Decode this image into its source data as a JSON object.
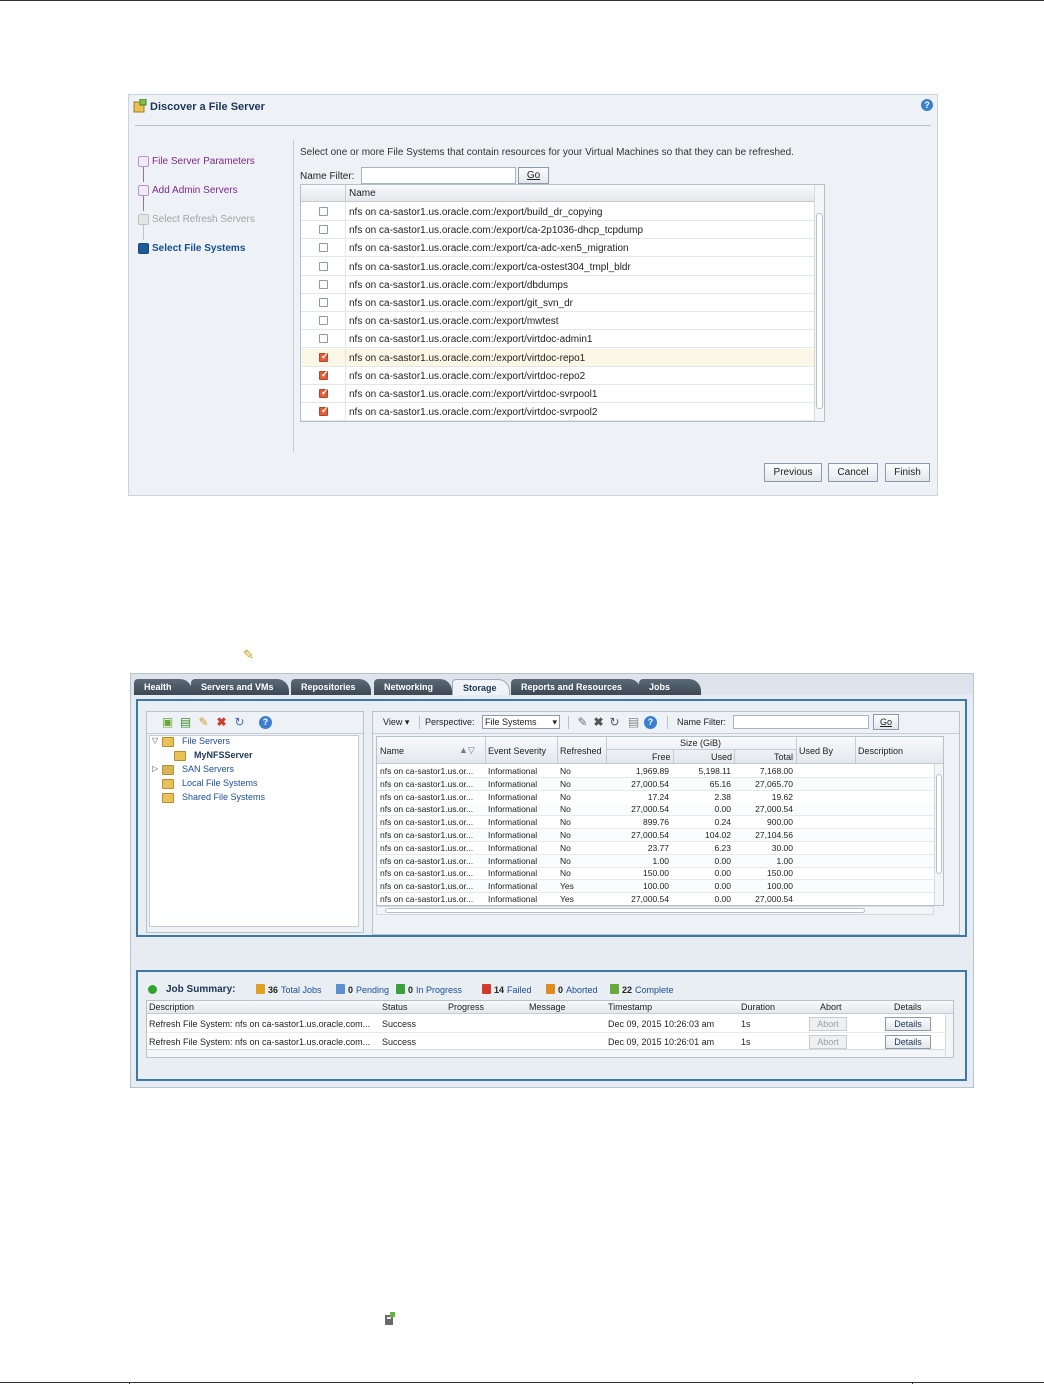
{
  "discover_dialog": {
    "title": "Discover a File Server",
    "help_icon": "?",
    "train_steps": [
      {
        "label": "File Server Parameters",
        "state": "visited"
      },
      {
        "label": "Add Admin Servers",
        "state": "visited"
      },
      {
        "label": "Select Refresh Servers",
        "state": "disabled"
      },
      {
        "label": "Select File Systems",
        "state": "current"
      }
    ],
    "instruction": "Select one or more File Systems that contain resources for your Virtual Machines so that they can be refreshed.",
    "name_filter_label": "Name Filter:",
    "name_filter_value": "",
    "go_label": "Go",
    "table_header_name": "Name",
    "file_systems": [
      {
        "name": "nfs on ca-sastor1.us.oracle.com:/export/build_dr_copying",
        "checked": false
      },
      {
        "name": "nfs on ca-sastor1.us.oracle.com:/export/ca-2p1036-dhcp_tcpdump",
        "checked": false
      },
      {
        "name": "nfs on ca-sastor1.us.oracle.com:/export/ca-adc-xen5_migration",
        "checked": false
      },
      {
        "name": "nfs on ca-sastor1.us.oracle.com:/export/ca-ostest304_tmpl_bldr",
        "checked": false
      },
      {
        "name": "nfs on ca-sastor1.us.oracle.com:/export/dbdumps",
        "checked": false
      },
      {
        "name": "nfs on ca-sastor1.us.oracle.com:/export/git_svn_dr",
        "checked": false
      },
      {
        "name": "nfs on ca-sastor1.us.oracle.com:/export/mwtest",
        "checked": false
      },
      {
        "name": "nfs on ca-sastor1.us.oracle.com:/export/virtdoc-admin1",
        "checked": false
      },
      {
        "name": "nfs on ca-sastor1.us.oracle.com:/export/virtdoc-repo1",
        "checked": true
      },
      {
        "name": "nfs on ca-sastor1.us.oracle.com:/export/virtdoc-repo2",
        "checked": true
      },
      {
        "name": "nfs on ca-sastor1.us.oracle.com:/export/virtdoc-svrpool1",
        "checked": true
      },
      {
        "name": "nfs on ca-sastor1.us.oracle.com:/export/virtdoc-svrpool2",
        "checked": true
      }
    ],
    "buttons": {
      "previous": "Previous",
      "cancel": "Cancel",
      "finish": "Finish"
    }
  },
  "storage_app": {
    "tabs": [
      {
        "label": "Health",
        "active": false
      },
      {
        "label": "Servers and VMs",
        "active": false
      },
      {
        "label": "Repositories",
        "active": false
      },
      {
        "label": "Networking",
        "active": false
      },
      {
        "label": "Storage",
        "active": true
      },
      {
        "label": "Reports and Resources",
        "active": false
      },
      {
        "label": "Jobs",
        "active": false
      }
    ],
    "tree": {
      "toolbar_icons": [
        "add-folder-icon",
        "discover-icon",
        "edit-icon",
        "delete-icon",
        "refresh-icon",
        "help-icon"
      ],
      "nodes": [
        {
          "label": "File Servers",
          "level": 0,
          "expanded": true
        },
        {
          "label": "MyNFSServer",
          "level": 1,
          "selected": true
        },
        {
          "label": "SAN Servers",
          "level": 0,
          "expanded": false
        },
        {
          "label": "Local File Systems",
          "level": 0
        },
        {
          "label": "Shared File Systems",
          "level": 0
        }
      ]
    },
    "grid_toolbar": {
      "view_label": "View ▾",
      "perspective_label": "Perspective:",
      "perspective_value": "File Systems",
      "name_filter_label": "Name Filter:",
      "go_label": "Go"
    },
    "grid_headers": {
      "name": "Name",
      "severity": "Event Severity",
      "refreshed": "Refreshed",
      "size_group": "Size (GiB)",
      "free": "Free",
      "used": "Used",
      "total": "Total",
      "used_by": "Used By",
      "description": "Description"
    },
    "grid_rows": [
      {
        "name": "nfs on ca-sastor1.us.or...",
        "severity": "Informational",
        "refreshed": "No",
        "free": "1,969.89",
        "used": "5,198.11",
        "total": "7,168.00"
      },
      {
        "name": "nfs on ca-sastor1.us.or...",
        "severity": "Informational",
        "refreshed": "No",
        "free": "27,000.54",
        "used": "65.16",
        "total": "27,065.70"
      },
      {
        "name": "nfs on ca-sastor1.us.or...",
        "severity": "Informational",
        "refreshed": "No",
        "free": "17.24",
        "used": "2.38",
        "total": "19.62"
      },
      {
        "name": "nfs on ca-sastor1.us.or...",
        "severity": "Informational",
        "refreshed": "No",
        "free": "27,000.54",
        "used": "0.00",
        "total": "27,000.54"
      },
      {
        "name": "nfs on ca-sastor1.us.or...",
        "severity": "Informational",
        "refreshed": "No",
        "free": "899.76",
        "used": "0.24",
        "total": "900.00"
      },
      {
        "name": "nfs on ca-sastor1.us.or...",
        "severity": "Informational",
        "refreshed": "No",
        "free": "27,000.54",
        "used": "104.02",
        "total": "27,104.56"
      },
      {
        "name": "nfs on ca-sastor1.us.or...",
        "severity": "Informational",
        "refreshed": "No",
        "free": "23.77",
        "used": "6.23",
        "total": "30.00"
      },
      {
        "name": "nfs on ca-sastor1.us.or...",
        "severity": "Informational",
        "refreshed": "No",
        "free": "1.00",
        "used": "0.00",
        "total": "1.00"
      },
      {
        "name": "nfs on ca-sastor1.us.or...",
        "severity": "Informational",
        "refreshed": "No",
        "free": "150.00",
        "used": "0.00",
        "total": "150.00"
      },
      {
        "name": "nfs on ca-sastor1.us.or...",
        "severity": "Informational",
        "refreshed": "Yes",
        "free": "100.00",
        "used": "0.00",
        "total": "100.00"
      },
      {
        "name": "nfs on ca-sastor1.us.or...",
        "severity": "Informational",
        "refreshed": "Yes",
        "free": "27,000.54",
        "used": "0.00",
        "total": "27,000.54"
      }
    ],
    "job_summary": {
      "title": "Job Summary:",
      "stats": [
        {
          "count": "36",
          "label": "Total Jobs",
          "color": "#e0a020"
        },
        {
          "count": "0",
          "label": "Pending",
          "color": "#5a8fd0"
        },
        {
          "count": "0",
          "label": "In Progress",
          "color": "#3aa03a"
        },
        {
          "count": "14",
          "label": "Failed",
          "color": "#d23a2a"
        },
        {
          "count": "0",
          "label": "Aborted",
          "color": "#e08a20"
        },
        {
          "count": "22",
          "label": "Complete",
          "color": "#6aa83a"
        }
      ],
      "headers": {
        "description": "Description",
        "status": "Status",
        "progress": "Progress",
        "message": "Message",
        "timestamp": "Timestamp",
        "duration": "Duration",
        "abort": "Abort",
        "details": "Details"
      },
      "rows": [
        {
          "description": "Refresh File System: nfs on ca-sastor1.us.oracle.com...",
          "status": "Success",
          "progress": "",
          "message": "",
          "timestamp": "Dec 09, 2015 10:26:03 am",
          "duration": "1s",
          "abort": "Abort",
          "details": "Details"
        },
        {
          "description": "Refresh File System: nfs on ca-sastor1.us.oracle.com...",
          "status": "Success",
          "progress": "",
          "message": "",
          "timestamp": "Dec 09, 2015 10:26:01 am",
          "duration": "1s",
          "abort": "Abort",
          "details": "Details"
        }
      ]
    }
  }
}
